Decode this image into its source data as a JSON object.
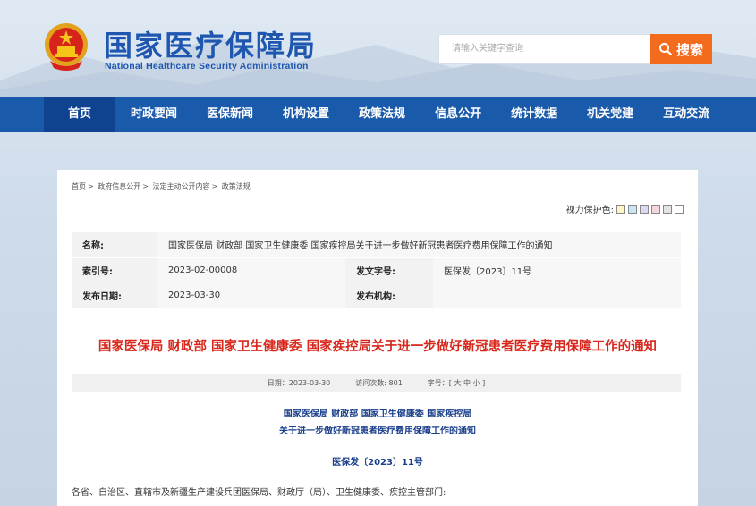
{
  "header": {
    "title": "国家医疗保障局",
    "subtitle": "National Healthcare Security Administration",
    "search_placeholder": "请输入关键字查询",
    "search_button": "搜索"
  },
  "nav": {
    "items": [
      "首页",
      "时政要闻",
      "医保新闻",
      "机构设置",
      "政策法规",
      "信息公开",
      "统计数据",
      "机关党建",
      "互动交流"
    ]
  },
  "breadcrumb": [
    "首页",
    ">",
    "政府信息公开",
    ">",
    "法定主动公开内容",
    ">",
    "政策法规"
  ],
  "vision": {
    "label": "视力保护色:",
    "colors": [
      "#fdf5c4",
      "#c8e6f4",
      "#dcd7f2",
      "#f4d6dc",
      "#e3e3e3",
      "#ffffff"
    ]
  },
  "info": {
    "name_label": "名称:",
    "name_value": "国家医保局 财政部 国家卫生健康委 国家疾控局关于进一步做好新冠患者医疗费用保障工作的通知",
    "index_label": "索引号:",
    "index_value": "2023-02-00008",
    "docno_label": "发文字号:",
    "docno_value": "医保发〔2023〕11号",
    "date_label": "发布日期:",
    "date_value": "2023-03-30",
    "org_label": "发布机构:",
    "org_value": ""
  },
  "document": {
    "title": "国家医保局 财政部 国家卫生健康委 国家疾控局关于进一步做好新冠患者医疗费用保障工作的通知",
    "meta_date": "日期：2023-03-30",
    "meta_visits": "访问次数:  801",
    "meta_font": "字号：[ 大 中 小 ]",
    "issuer_line1": "国家医保局 财政部 国家卫生健康委 国家疾控局",
    "issuer_line2": "关于进一步做好新冠患者医疗费用保障工作的通知",
    "number": "医保发〔2023〕11号",
    "salutation": "各省、自治区、直辖市及新疆生产建设兵团医保局、财政厅（局）、卫生健康委、疾控主管部门:"
  }
}
